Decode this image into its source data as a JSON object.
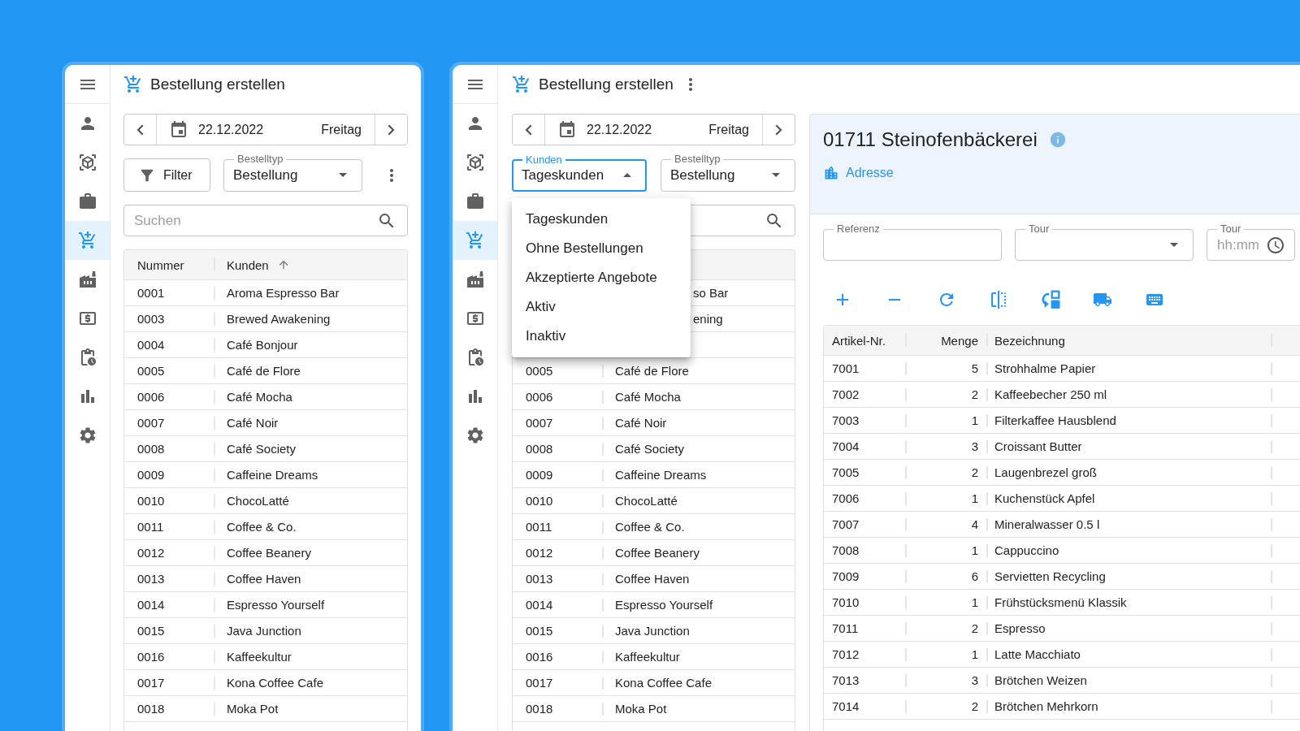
{
  "left_window": {
    "sidebar": {
      "items": [
        {
          "selected": false
        },
        {
          "selected": false
        },
        {
          "selected": false
        },
        {
          "selected": true
        },
        {
          "selected": false
        },
        {
          "selected": false
        },
        {
          "selected": false
        },
        {
          "selected": false
        },
        {
          "selected": false
        }
      ]
    },
    "title": "Bestellung erstellen",
    "date_nav": {
      "date": "22.12.2022",
      "weekday": "Freitag"
    },
    "filter_button": {
      "label": "Filter"
    },
    "order_type": {
      "label": "Bestelltyp",
      "value": "Bestellung",
      "open": false
    },
    "search": {
      "placeholder": "Suchen"
    },
    "table": {
      "columns": [
        {
          "label": "Nummer",
          "sorted": false
        },
        {
          "label": "Kunden",
          "sorted": true
        }
      ],
      "rows": [
        [
          "0001",
          "Aroma Espresso Bar"
        ],
        [
          "0003",
          "Brewed Awakening"
        ],
        [
          "0004",
          "Café Bonjour"
        ],
        [
          "0005",
          "Café de Flore"
        ],
        [
          "0006",
          "Café Mocha"
        ],
        [
          "0007",
          "Café Noir"
        ],
        [
          "0008",
          "Café Society"
        ],
        [
          "0009",
          "Caffeine Dreams"
        ],
        [
          "0010",
          "ChocoLatté"
        ],
        [
          "0011",
          "Coffee & Co."
        ],
        [
          "0012",
          "Coffee Beanery"
        ],
        [
          "0013",
          "Coffee Haven"
        ],
        [
          "0014",
          "Espresso Yourself"
        ],
        [
          "0015",
          "Java Junction"
        ],
        [
          "0016",
          "Kaffeekultur"
        ],
        [
          "0017",
          "Kona Coffee Cafe"
        ],
        [
          "0018",
          "Moka Pot"
        ]
      ]
    }
  },
  "right_window": {
    "sidebar": {
      "items": [
        {
          "selected": false
        },
        {
          "selected": false
        },
        {
          "selected": false
        },
        {
          "selected": true
        },
        {
          "selected": false
        },
        {
          "selected": false
        },
        {
          "selected": false
        },
        {
          "selected": false
        },
        {
          "selected": false
        }
      ]
    },
    "title": "Bestellung erstellen",
    "date_nav": {
      "date": "22.12.2022",
      "weekday": "Freitag"
    },
    "customer_filter": {
      "label": "Kunden",
      "value": "Tageskunden",
      "open": true,
      "options": [
        {
          "label": "Tageskunden"
        },
        {
          "label": "Ohne Bestellungen"
        },
        {
          "label": "Akzeptierte Angebote"
        },
        {
          "label": "Aktiv"
        },
        {
          "label": "Inaktiv"
        }
      ]
    },
    "order_type": {
      "label": "Bestelltyp",
      "value": "Bestellung",
      "open": false
    },
    "table": {
      "rows": [
        {
          "column_2": "so Bar"
        },
        {
          "column_2": "ening"
        },
        {},
        {
          "column_1": "0005",
          "column_2": "Café de Flore"
        },
        {
          "column_1": "0006",
          "column_2": "Café Mocha"
        },
        {
          "column_1": "0007",
          "column_2": "Café Noir"
        },
        {
          "column_1": "0008",
          "column_2": "Café Society"
        },
        {
          "column_1": "0009",
          "column_2": "Caffeine Dreams"
        },
        {
          "column_1": "0010",
          "column_2": "ChocoLatté"
        },
        {
          "column_1": "0011",
          "column_2": "Coffee & Co."
        },
        {
          "column_1": "0012",
          "column_2": "Coffee Beanery"
        },
        {
          "column_1": "0013",
          "column_2": "Coffee Haven"
        },
        {
          "column_1": "0014",
          "column_2": "Espresso Yourself"
        },
        {
          "column_1": "0015",
          "column_2": "Java Junction"
        },
        {
          "column_1": "0016",
          "column_2": "Kaffeekultur"
        },
        {
          "column_1": "0017",
          "column_2": "Kona Coffee Cafe"
        },
        {
          "column_1": "0018",
          "column_2": "Moka Pot"
        }
      ]
    },
    "customer": {
      "title": "01711 Steinofenbäckerei",
      "address_link": "Adresse"
    },
    "fields": [
      {
        "kind": "text",
        "label": "Referenz"
      },
      {
        "kind": "select",
        "label": "Tour"
      },
      {
        "kind": "time",
        "label": "Tour",
        "placeholder": "hh:mm"
      }
    ],
    "items_table": {
      "columns": [
        {
          "label": "Artikel-Nr.",
          "numeric": false
        },
        {
          "label": "Menge",
          "numeric": true
        },
        {
          "label": "Bezeichnung",
          "numeric": false
        }
      ],
      "rows": [
        [
          "7001",
          "5",
          "Strohhalme Papier"
        ],
        [
          "7002",
          "2",
          "Kaffeebecher 250 ml"
        ],
        [
          "7003",
          "1",
          "Filterkaffee Hausblend"
        ],
        [
          "7004",
          "3",
          "Croissant Butter"
        ],
        [
          "7005",
          "2",
          "Laugenbrezel groß"
        ],
        [
          "7006",
          "1",
          "Kuchenstück Apfel"
        ],
        [
          "7007",
          "4",
          "Mineralwasser 0.5 l"
        ],
        [
          "7008",
          "1",
          "Cappuccino"
        ],
        [
          "7009",
          "6",
          "Servietten Recycling"
        ],
        [
          "7010",
          "1",
          "Frühstücksmenü Klassik"
        ],
        [
          "7011",
          "2",
          "Espresso"
        ],
        [
          "7012",
          "1",
          "Latte Macchiato"
        ],
        [
          "7013",
          "3",
          "Brötchen Weizen"
        ],
        [
          "7014",
          "2",
          "Brötchen Mehrkorn"
        ]
      ]
    }
  }
}
